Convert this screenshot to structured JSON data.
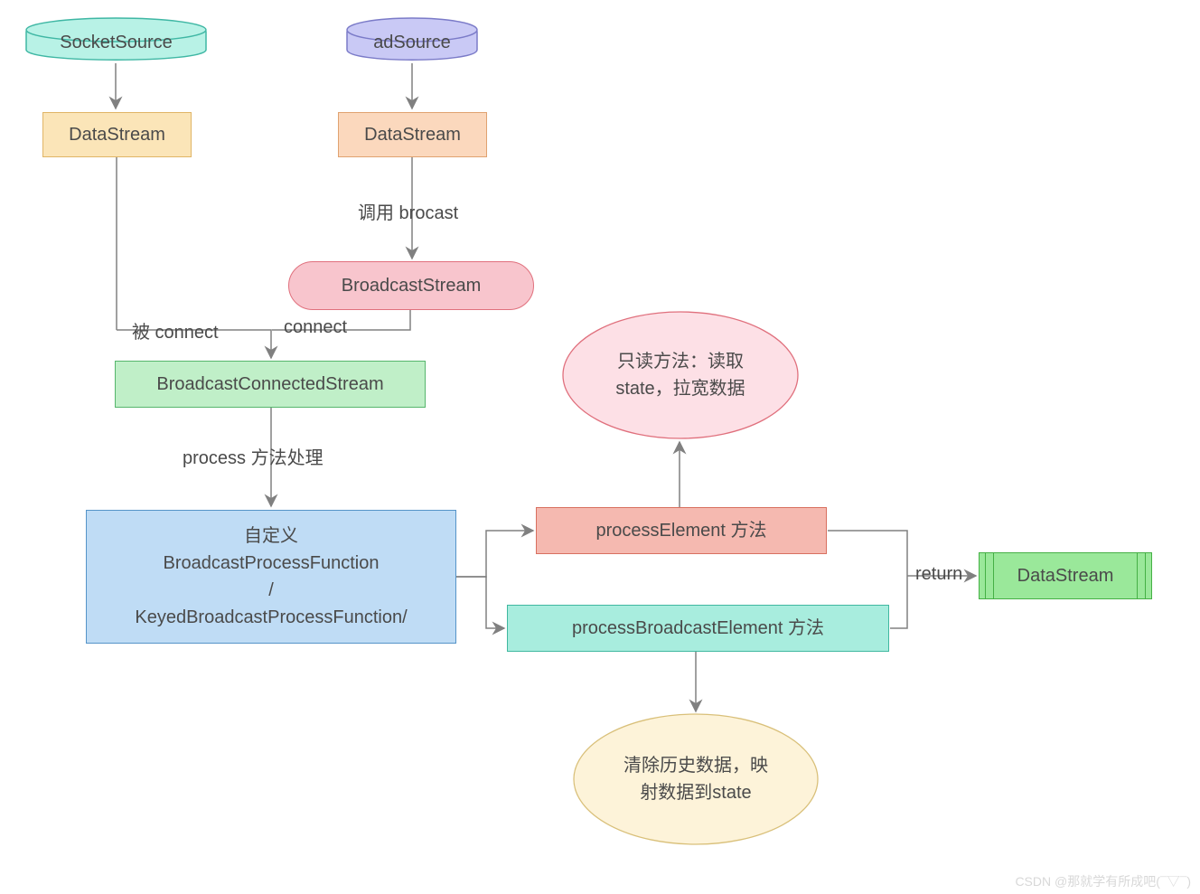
{
  "nodes": {
    "socketSource": "SocketSource",
    "adSource": "adSource",
    "dataStream1": "DataStream",
    "dataStream2": "DataStream",
    "callBrocast": "调用 brocast",
    "broadcastStream": "BroadcastStream",
    "beConnect": "被 connect",
    "connect": "connect",
    "broadcastConnectedStream": "BroadcastConnectedStream",
    "processMethod": "process 方法处理",
    "customFunc_l1": "自定义",
    "customFunc_l2": "BroadcastProcessFunction",
    "customFunc_l3": "/",
    "customFunc_l4": "KeyedBroadcastProcessFunction/",
    "processElement": "processElement 方法",
    "processBroadcastElement": "processBroadcastElement 方法",
    "returnLabel": "return",
    "readonlyNote_l1": "只读方法：读取",
    "readonlyNote_l2": "state，拉宽数据",
    "clearNote_l1": "清除历史数据，映",
    "clearNote_l2": "射数据到state",
    "finalDataStream": "DataStream"
  },
  "watermark": "CSDN @那就学有所成吧(¯▽¯​)"
}
